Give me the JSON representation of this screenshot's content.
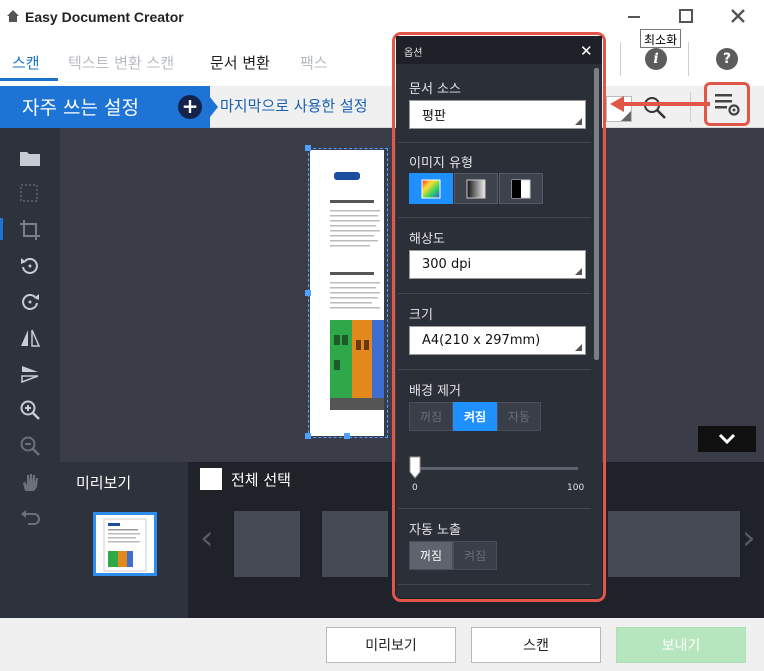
{
  "window": {
    "title": "Easy Document Creator",
    "tooltip": "최소화"
  },
  "tabs": [
    {
      "label": "스캔"
    },
    {
      "label": "텍스트 변환 스캔"
    },
    {
      "label": "문서 변환"
    },
    {
      "label": "팩스"
    }
  ],
  "preset": {
    "title": "자주 쓰는 설정",
    "last_used": "마지막으로 사용한 설정"
  },
  "options": {
    "title": "옵션",
    "document_source": {
      "label": "문서 소스",
      "value": "평판"
    },
    "image_type": {
      "label": "이미지 유형"
    },
    "resolution": {
      "label": "해상도",
      "value": "300 dpi"
    },
    "size": {
      "label": "크기",
      "value": "A4(210 x 297mm)"
    },
    "background_removal": {
      "label": "배경 제거",
      "options": [
        "꺼짐",
        "켜짐",
        "자동"
      ],
      "slider_min": "0",
      "slider_max": "100",
      "slider_value": 0
    },
    "auto_exposure": {
      "label": "자동 노출",
      "options": [
        "꺼짐",
        "켜짐"
      ]
    }
  },
  "bottom": {
    "preview_label": "미리보기",
    "select_all_label": "전체 선택"
  },
  "footer": {
    "preview_button": "미리보기",
    "scan_button": "스캔",
    "send_button": "보내기"
  },
  "colors": {
    "accent": "#1e74d4",
    "callout": "#e0574a",
    "send_disabled": "#b6e6be"
  }
}
